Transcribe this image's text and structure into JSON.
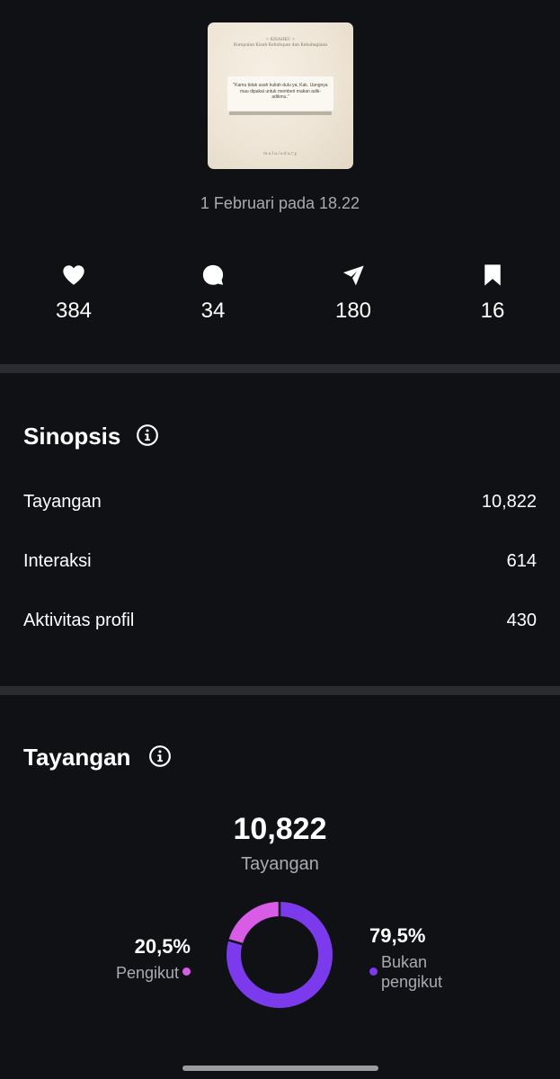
{
  "post": {
    "thumbnail": {
      "header_line1": "✧ KISAHKU ✧",
      "header_line2": "Kumpulan Kisah Kehidupan dan Kebahagiaan",
      "quote": "\"Kamu tidak usah kuliah dulu ya, Kak. Uangnya mau dipakai untuk memberi makan adik-adikmu.\"",
      "signature": "maluisdury"
    },
    "date": "1 Februari pada 18.22",
    "stats": {
      "likes": "384",
      "comments": "34",
      "shares": "180",
      "saves": "16"
    }
  },
  "synopsis": {
    "title": "Sinopsis",
    "rows": [
      {
        "label": "Tayangan",
        "value": "10,822"
      },
      {
        "label": "Interaksi",
        "value": "614"
      },
      {
        "label": "Aktivitas profil",
        "value": "430"
      }
    ]
  },
  "views": {
    "title": "Tayangan",
    "total": "10,822",
    "total_label": "Tayangan",
    "followers": {
      "percent_label": "20,5%",
      "label": "Pengikut",
      "value": 20.5,
      "color": "#d85ce6"
    },
    "non_followers": {
      "percent_label": "79,5%",
      "label_line1": "Bukan",
      "label_line2": "pengikut",
      "value": 79.5,
      "color": "#7c3aed"
    }
  },
  "colors": {
    "background": "#0f1115",
    "divider": "#2a2c31",
    "muted_text": "#a8abb2"
  }
}
